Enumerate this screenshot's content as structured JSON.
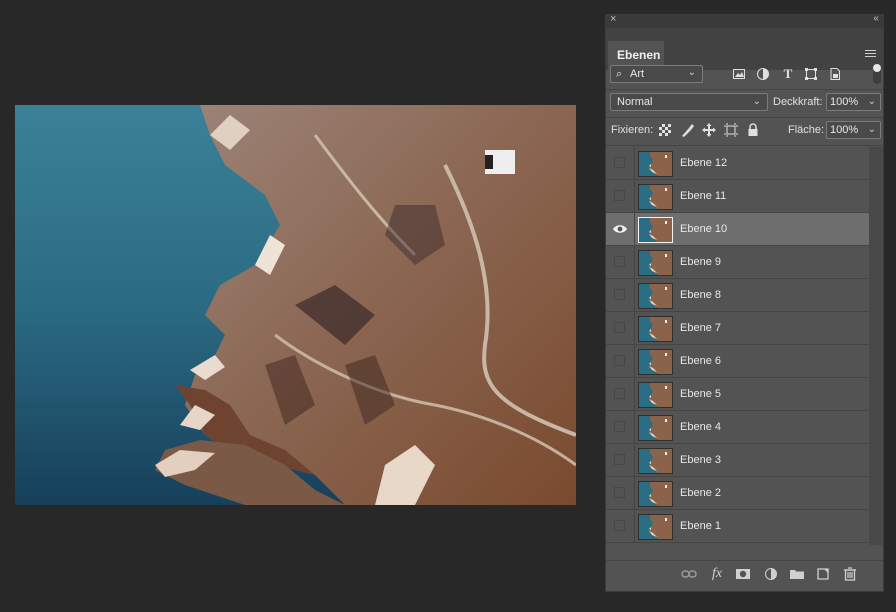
{
  "panel": {
    "close_glyph": "×",
    "collapse_glyph": "‹‹",
    "tab_label": "Ebenen",
    "filter": {
      "label": "Art"
    },
    "blend_mode": "Normal",
    "opacity_label": "Deckkraft:",
    "opacity_value": "100%",
    "lock_label": "Fixieren:",
    "fill_label": "Fläche:",
    "fill_value": "100%",
    "filter_icons": [
      "image-filter-icon",
      "adjustment-filter-icon",
      "type-filter-icon",
      "shape-filter-icon",
      "smart-object-filter-icon"
    ],
    "lock_icons": [
      "lock-transparent-pixels-icon",
      "lock-image-pixels-icon",
      "lock-position-icon",
      "lock-artboard-icon",
      "lock-all-icon"
    ],
    "bottom_icons": [
      "link-layers-icon",
      "fx-icon",
      "mask-icon",
      "adjustment-layer-icon",
      "group-folder-icon",
      "new-layer-icon",
      "trash-icon"
    ]
  },
  "layers": [
    {
      "name": "Ebene 12",
      "visible": false,
      "selected": false
    },
    {
      "name": "Ebene 11",
      "visible": false,
      "selected": false
    },
    {
      "name": "Ebene 10",
      "visible": true,
      "selected": true
    },
    {
      "name": "Ebene 9",
      "visible": false,
      "selected": false
    },
    {
      "name": "Ebene 8",
      "visible": false,
      "selected": false
    },
    {
      "name": "Ebene 7",
      "visible": false,
      "selected": false
    },
    {
      "name": "Ebene 6",
      "visible": false,
      "selected": false
    },
    {
      "name": "Ebene 5",
      "visible": false,
      "selected": false
    },
    {
      "name": "Ebene 4",
      "visible": false,
      "selected": false
    },
    {
      "name": "Ebene 3",
      "visible": false,
      "selected": false
    },
    {
      "name": "Ebene 2",
      "visible": false,
      "selected": false
    },
    {
      "name": "Ebene 1",
      "visible": false,
      "selected": false
    }
  ],
  "colors": {
    "workspace": "#282828",
    "panel": "#535353",
    "selected_layer": "#6e6e6e",
    "sea": "#2d6e84",
    "land": "#8a5a3c"
  }
}
